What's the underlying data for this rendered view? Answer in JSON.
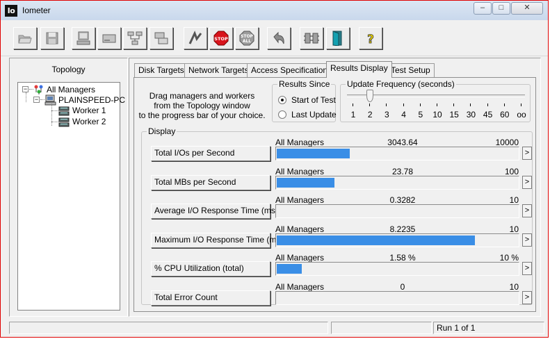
{
  "window": {
    "title": "Iometer",
    "app_icon": "Io"
  },
  "toolbar": {
    "buttons": [
      {
        "name": "open-icon"
      },
      {
        "name": "save-icon"
      },
      {
        "name": "new-manager-icon"
      },
      {
        "name": "new-disk-worker-icon"
      },
      {
        "name": "new-network-worker-icon"
      },
      {
        "name": "duplicate-worker-icon"
      },
      {
        "name": "start-tests-icon"
      },
      {
        "name": "stop-icon",
        "label": "STOP"
      },
      {
        "name": "stop-all-icon",
        "label": "STOP ALL"
      },
      {
        "name": "reset-workers-icon"
      },
      {
        "name": "disconnect-icon"
      },
      {
        "name": "exit-icon"
      },
      {
        "name": "about-icon",
        "label": "?"
      }
    ]
  },
  "topology": {
    "title": "Topology",
    "root": "All Managers",
    "manager": "PLAINSPEED-PC",
    "workers": [
      "Worker 1",
      "Worker 2"
    ]
  },
  "tabs": [
    "Disk Targets",
    "Network Targets",
    "Access Specifications",
    "Results Display",
    "Test Setup"
  ],
  "active_tab": "Results Display",
  "instructions": [
    "Drag managers and workers",
    "from the Topology window",
    "to the progress bar of your choice."
  ],
  "results_since": {
    "label": "Results Since",
    "options": [
      "Start of Test",
      "Last Update"
    ],
    "selected": "Start of Test"
  },
  "update_frequency": {
    "label": "Update Frequency (seconds)",
    "ticks": [
      "1",
      "2",
      "3",
      "4",
      "5",
      "10",
      "15",
      "30",
      "45",
      "60",
      "oo"
    ],
    "selected": "2"
  },
  "display": {
    "label": "Display",
    "rows": [
      {
        "metric": "Total I/Os per Second",
        "source": "All Managers",
        "value": "3043.64",
        "max": "10000",
        "fraction": 0.304
      },
      {
        "metric": "Total MBs per Second",
        "source": "All Managers",
        "value": "23.78",
        "max": "100",
        "fraction": 0.238
      },
      {
        "metric": "Average I/O Response Time (ms)",
        "source": "All Managers",
        "value": "0.3282",
        "max": "10",
        "fraction": 0.0
      },
      {
        "metric": "Maximum I/O Response Time (ms)",
        "source": "All Managers",
        "value": "8.2235",
        "max": "10",
        "fraction": 0.8224
      },
      {
        "metric": "% CPU Utilization (total)",
        "source": "All Managers",
        "value": "1.58 %",
        "max": "10 %",
        "fraction": 0.105
      },
      {
        "metric": "Total Error Count",
        "source": "All Managers",
        "value": "0",
        "max": "10",
        "fraction": 0.0
      }
    ],
    "arrow_label": ">"
  },
  "status": {
    "run": "Run 1 of 1"
  },
  "colors": {
    "bar_fill": "#3a8ee6",
    "frame_border": "#e00000"
  }
}
